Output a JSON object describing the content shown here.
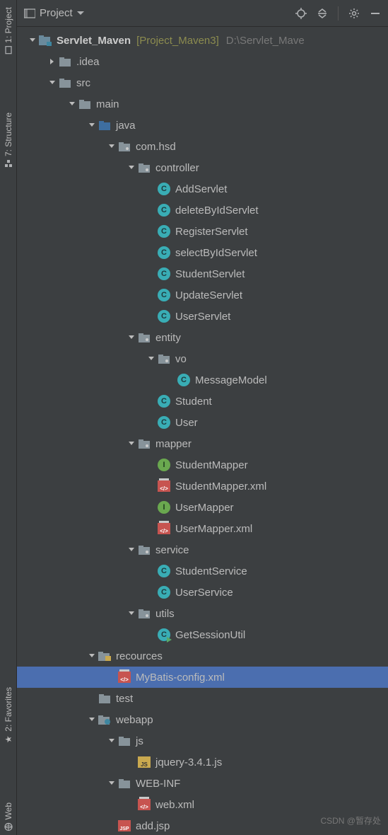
{
  "leftbar": [
    {
      "label": "1: Project",
      "icon": "file"
    },
    {
      "label": "7: Structure",
      "icon": "structure"
    },
    {
      "label": "2: Favorites",
      "icon": "star"
    },
    {
      "label": "Web",
      "icon": "globe"
    }
  ],
  "toolbar": {
    "title": "Project"
  },
  "watermark": "CSDN @暂存处",
  "tree": [
    {
      "d": 0,
      "exp": "down",
      "icon": "module",
      "label": "Servlet_Maven",
      "bold": true,
      "bracket": "[Project_Maven3]",
      "path": "D:\\Servlet_Mave"
    },
    {
      "d": 1,
      "exp": "right",
      "icon": "folder",
      "label": ".idea"
    },
    {
      "d": 1,
      "exp": "down",
      "icon": "folder",
      "label": "src"
    },
    {
      "d": 2,
      "exp": "down",
      "icon": "folder",
      "label": "main"
    },
    {
      "d": 3,
      "exp": "down",
      "icon": "folder-src",
      "label": "java"
    },
    {
      "d": 4,
      "exp": "down",
      "icon": "package",
      "label": "com.hsd"
    },
    {
      "d": 5,
      "exp": "down",
      "icon": "package",
      "label": "controller"
    },
    {
      "d": 6,
      "exp": "",
      "icon": "class",
      "label": "AddServlet"
    },
    {
      "d": 6,
      "exp": "",
      "icon": "class",
      "label": "deleteByIdServlet"
    },
    {
      "d": 6,
      "exp": "",
      "icon": "class",
      "label": "RegisterServlet"
    },
    {
      "d": 6,
      "exp": "",
      "icon": "class",
      "label": "selectByIdServlet"
    },
    {
      "d": 6,
      "exp": "",
      "icon": "class",
      "label": "StudentServlet"
    },
    {
      "d": 6,
      "exp": "",
      "icon": "class",
      "label": "UpdateServlet"
    },
    {
      "d": 6,
      "exp": "",
      "icon": "class",
      "label": "UserServlet"
    },
    {
      "d": 5,
      "exp": "down",
      "icon": "package",
      "label": "entity"
    },
    {
      "d": 6,
      "exp": "down",
      "icon": "package",
      "label": "vo"
    },
    {
      "d": 7,
      "exp": "",
      "icon": "class",
      "label": "MessageModel"
    },
    {
      "d": 6,
      "exp": "",
      "icon": "class",
      "label": "Student"
    },
    {
      "d": 6,
      "exp": "",
      "icon": "class",
      "label": "User"
    },
    {
      "d": 5,
      "exp": "down",
      "icon": "package",
      "label": "mapper"
    },
    {
      "d": 6,
      "exp": "",
      "icon": "interface",
      "label": "StudentMapper"
    },
    {
      "d": 6,
      "exp": "",
      "icon": "xml",
      "label": "StudentMapper.xml"
    },
    {
      "d": 6,
      "exp": "",
      "icon": "interface",
      "label": "UserMapper"
    },
    {
      "d": 6,
      "exp": "",
      "icon": "xml",
      "label": "UserMapper.xml"
    },
    {
      "d": 5,
      "exp": "down",
      "icon": "package",
      "label": "service"
    },
    {
      "d": 6,
      "exp": "",
      "icon": "class",
      "label": "StudentService"
    },
    {
      "d": 6,
      "exp": "",
      "icon": "class",
      "label": "UserService"
    },
    {
      "d": 5,
      "exp": "down",
      "icon": "package",
      "label": "utils"
    },
    {
      "d": 6,
      "exp": "",
      "icon": "class-run",
      "label": "GetSessionUtil"
    },
    {
      "d": 3,
      "exp": "down",
      "icon": "folder-res",
      "label": "recources"
    },
    {
      "d": 4,
      "exp": "",
      "icon": "xml",
      "label": "MyBatis-config.xml",
      "selected": true
    },
    {
      "d": 3,
      "exp": "",
      "icon": "folder",
      "label": "test"
    },
    {
      "d": 3,
      "exp": "down",
      "icon": "folder-web",
      "label": "webapp"
    },
    {
      "d": 4,
      "exp": "down",
      "icon": "folder",
      "label": "js"
    },
    {
      "d": 5,
      "exp": "",
      "icon": "js",
      "label": "jquery-3.4.1.js"
    },
    {
      "d": 4,
      "exp": "down",
      "icon": "folder",
      "label": "WEB-INF"
    },
    {
      "d": 5,
      "exp": "",
      "icon": "xml",
      "label": "web.xml"
    },
    {
      "d": 4,
      "exp": "",
      "icon": "jsp",
      "label": "add.jsp"
    }
  ]
}
